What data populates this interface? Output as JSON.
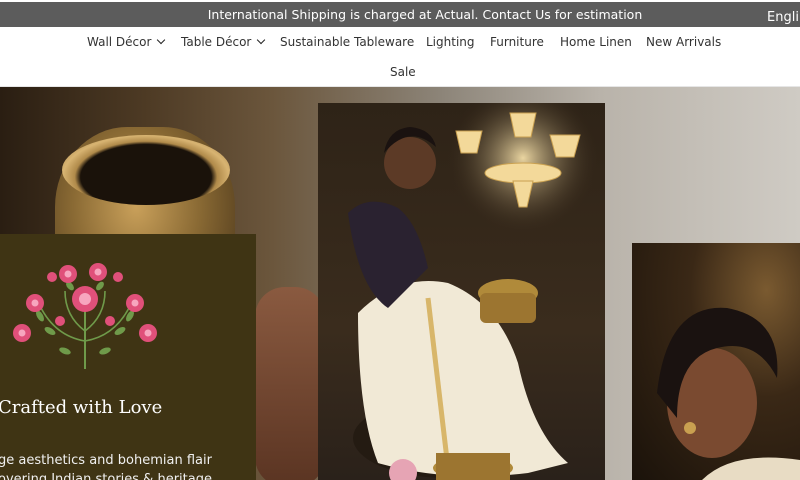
{
  "announcement": {
    "text": "International Shipping is charged at Actual. Contact Us for estimation",
    "language_label": "Engli"
  },
  "nav": {
    "items": [
      {
        "label": "Wall Décor",
        "has_dropdown": true
      },
      {
        "label": "Table Décor",
        "has_dropdown": true
      },
      {
        "label": "Sustainable Tableware",
        "has_dropdown": false
      },
      {
        "label": "Lighting",
        "has_dropdown": false
      },
      {
        "label": "Furniture",
        "has_dropdown": false
      },
      {
        "label": "Home Linen",
        "has_dropdown": false
      },
      {
        "label": "New Arrivals",
        "has_dropdown": false
      },
      {
        "label": "Sale",
        "has_dropdown": false
      }
    ]
  },
  "hero": {
    "card": {
      "title": "Crafted with Love",
      "line1": "ge aesthetics and bohemian flair",
      "line2": "overing Indian stories & heritage",
      "motif_icon": "floral-motif-icon",
      "background": "#3f3414"
    },
    "photos": [
      "brass-pot-photo",
      "woman-in-saree-photo",
      "woman-portrait-photo"
    ]
  },
  "colors": {
    "announcement_bg": "#5c5c5c",
    "nav_text": "#333333",
    "card_bg": "#3f3414",
    "flower_pink": "#e0507a",
    "flower_leaf": "#6f9a4a"
  }
}
